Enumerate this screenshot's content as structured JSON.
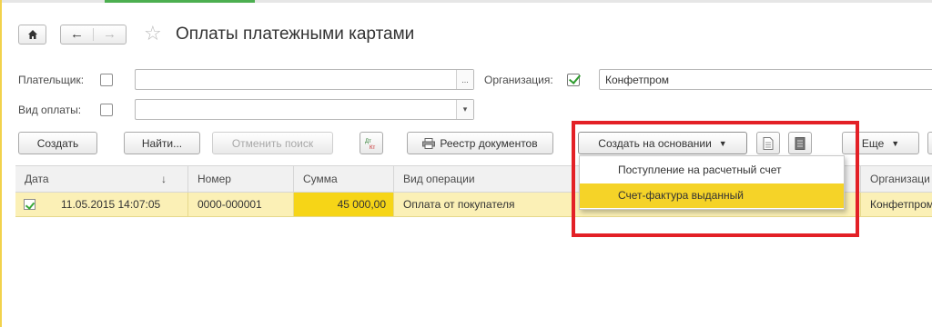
{
  "window": {
    "title": "Оплаты платежными картами"
  },
  "nav": {
    "home_icon": "home-icon",
    "back_icon": "←",
    "forward_icon": "→",
    "favorite_icon": "☆"
  },
  "filters": {
    "payer_label": "Плательщик:",
    "payer_checked": false,
    "payer_value": "",
    "payer_button": "...",
    "org_label": "Организация:",
    "org_checked": true,
    "org_value": "Конфетпром",
    "payment_type_label": "Вид оплаты:",
    "payment_type_checked": false,
    "payment_type_value": "",
    "payment_type_button": "▾"
  },
  "toolbar": {
    "create": "Создать",
    "find": "Найти...",
    "cancel_search": "Отменить поиск",
    "dt_kt": "Дт/Кт",
    "registry": "Реестр документов",
    "create_based_on": "Создать на основании",
    "more": "Еще",
    "caret": "▼"
  },
  "dropdown": {
    "items": [
      {
        "label": "Поступление на расчетный счет",
        "highlighted": false
      },
      {
        "label": "Счет-фактура выданный",
        "highlighted": true
      }
    ]
  },
  "table": {
    "columns": [
      "Дата",
      "Номер",
      "Сумма",
      "Вид операции",
      "Организаци"
    ],
    "sort_indicator": "↓",
    "rows": [
      {
        "date": "11.05.2015 14:07:05",
        "number": "0000-000001",
        "sum": "45 000,00",
        "operation": "Оплата от покупателя",
        "organization": "Конфетпром"
      }
    ]
  },
  "colors": {
    "row_highlight": "#fbf0b6",
    "sum_highlight": "#f6d517",
    "menu_highlight": "#f5d328",
    "annotation_frame": "#e32026"
  }
}
